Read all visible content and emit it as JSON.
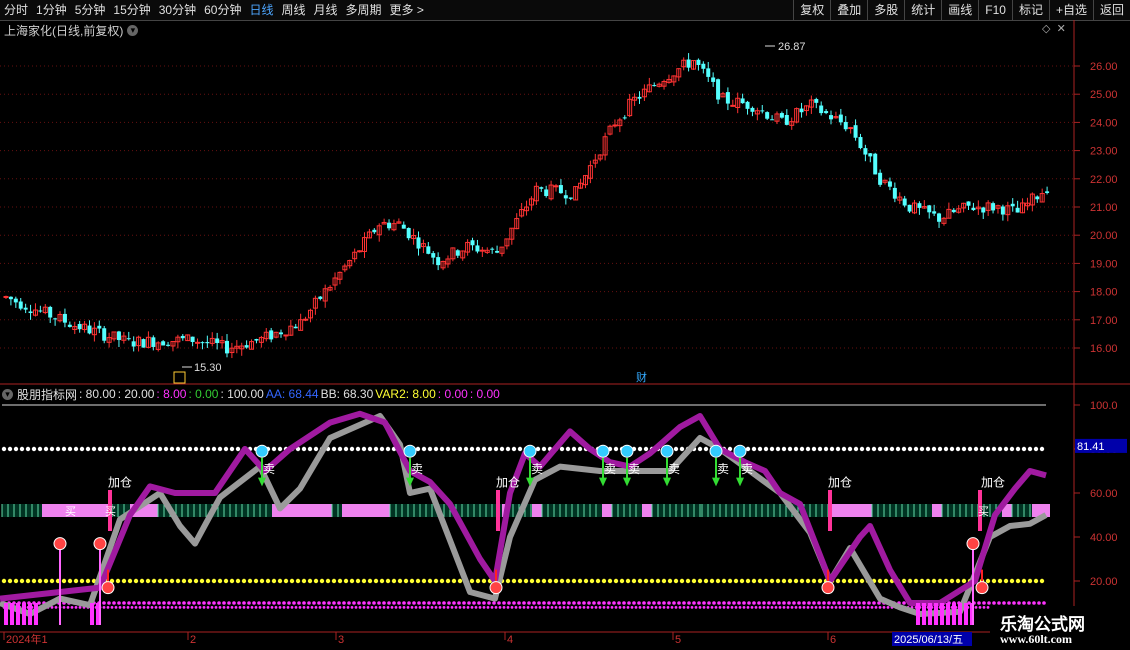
{
  "toolbar": {
    "periods": [
      "分时",
      "1分钟",
      "5分钟",
      "15分钟",
      "30分钟",
      "60分钟",
      "日线",
      "周线",
      "月线",
      "多周期",
      "更多 >"
    ],
    "active_period": "日线",
    "right_buttons": [
      "复权",
      "叠加",
      "多股",
      "统计",
      "画线",
      "F10",
      "标记",
      "+自选",
      "返回"
    ]
  },
  "stock": {
    "title": "上海家化(日线,前复权)",
    "high_label": "26.87",
    "low_label": "15.30",
    "cai_label": "财"
  },
  "indicator": {
    "name": "股朋指标网",
    "values": [
      {
        "text": ": 80.00",
        "color": "#e0e0e0"
      },
      {
        "text": ": 20.00",
        "color": "#e0e0e0"
      },
      {
        "text": ": 8.00",
        "color": "#ff33ff"
      },
      {
        "text": ": 0.00",
        "color": "#33cc33"
      },
      {
        "text": ": 100.00",
        "color": "#e0e0e0"
      },
      {
        "text": "AA: 68.44",
        "color": "#3366ff"
      },
      {
        "text": "BB: 68.30",
        "color": "#e0e0e0"
      },
      {
        "text": "VAR2: 8.00",
        "color": "#ffff33"
      },
      {
        "text": ": 0.00",
        "color": "#ff33ff"
      },
      {
        "text": ": 0.00",
        "color": "#ff33ff"
      }
    ],
    "current_value": "81.41",
    "labels": {
      "add": "加仓",
      "sell": "卖",
      "buy": "买"
    }
  },
  "axes": {
    "price_ticks": [
      "26.00",
      "25.00",
      "24.00",
      "23.00",
      "22.00",
      "21.00",
      "20.00",
      "19.00",
      "18.00",
      "17.00",
      "16.00"
    ],
    "ind_ticks": [
      "100.0",
      "80.00",
      "60.00",
      "40.00",
      "20.00"
    ],
    "dates": [
      "2024年1",
      "2",
      "3",
      "4",
      "5",
      "6"
    ],
    "current_date": "2025/06/13/五"
  },
  "colors": {
    "up": "#ff3333",
    "down": "#54ffff",
    "grid": "#661111",
    "purple": "#a01aa0",
    "gray": "#9a9a9a",
    "pink": "#ee82ee",
    "dots_white": "#ffffff",
    "dots_yellow": "#ffff33",
    "dots_magenta": "#ff33ff"
  },
  "watermark": {
    "line1": "乐淘公式网",
    "line2": "www.60lt.com"
  }
}
